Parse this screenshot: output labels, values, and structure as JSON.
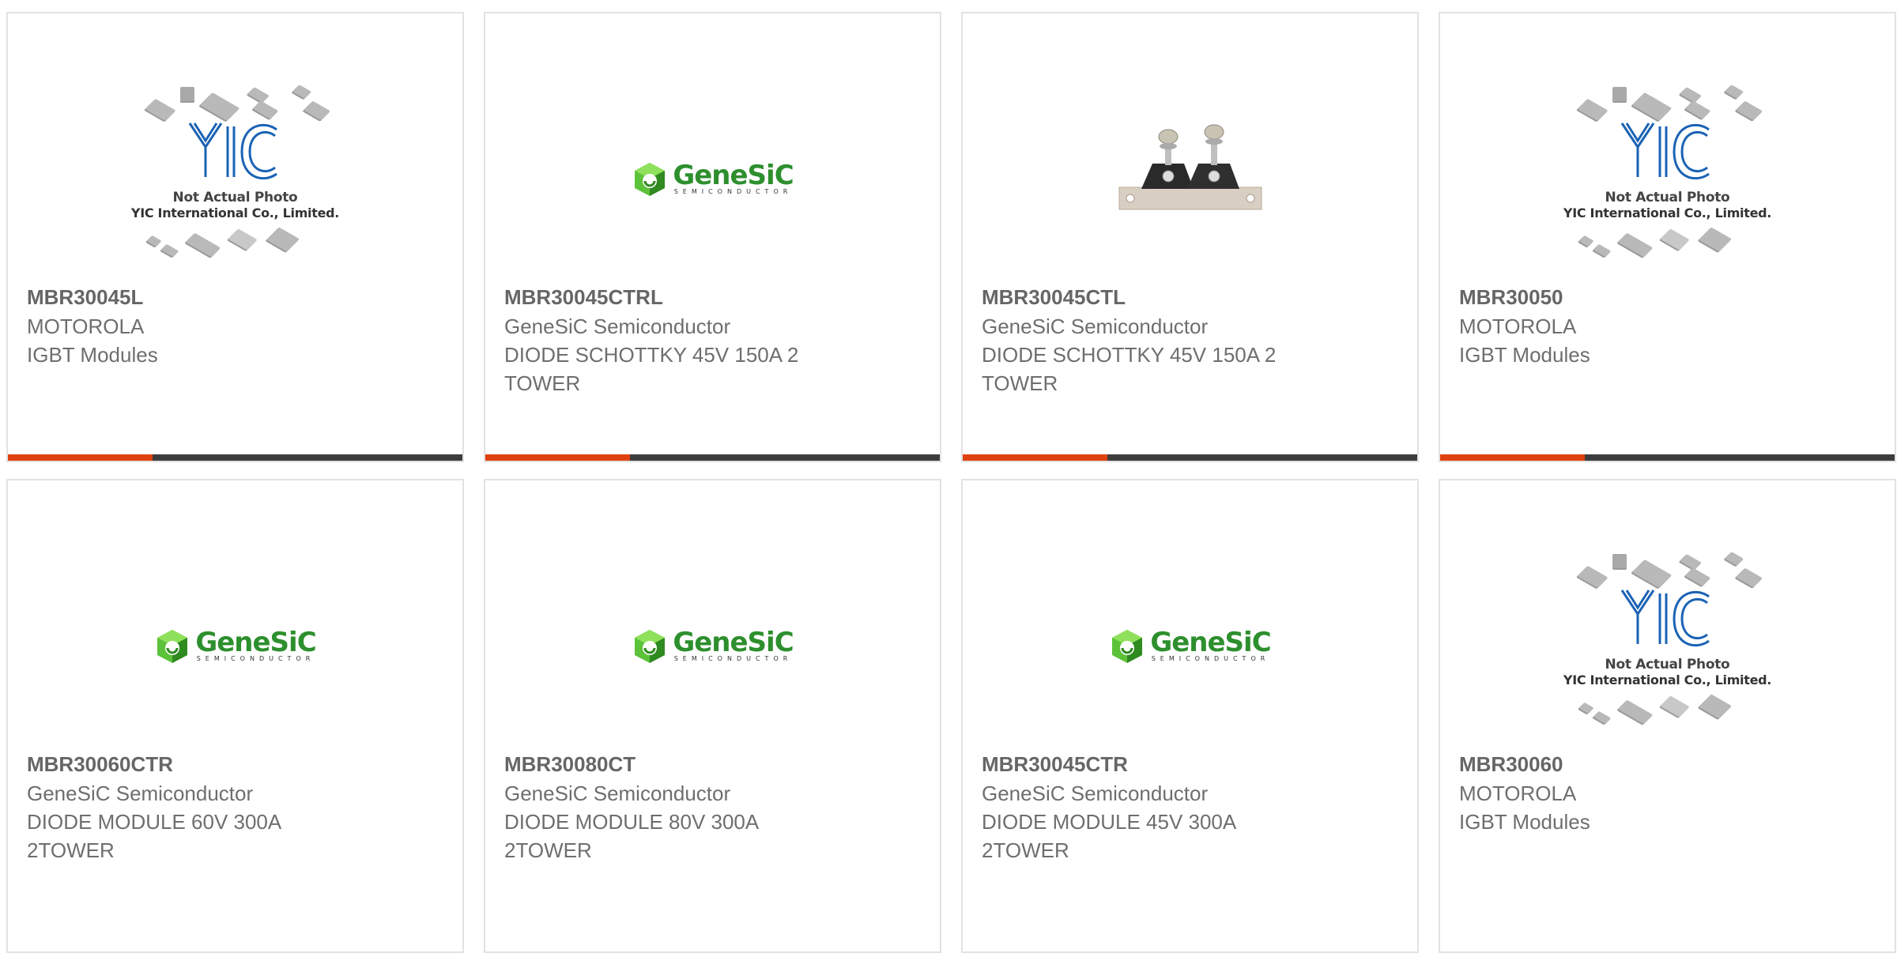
{
  "colors": {
    "accent": "#e0420f",
    "bar": "#3d3d3d",
    "genesic_green": "#3aa82a"
  },
  "products": [
    {
      "image": "yic-placeholder",
      "part": "MBR30045L",
      "maker": "MOTOROLA",
      "desc": "IGBT Modules"
    },
    {
      "image": "genesic-logo",
      "part": "MBR30045CTRL",
      "maker": "GeneSiC Semiconductor",
      "desc": "DIODE SCHOTTKY 45V 150A 2 TOWER"
    },
    {
      "image": "two-tower-diode-photo",
      "part": "MBR30045CTL",
      "maker": "GeneSiC Semiconductor",
      "desc": "DIODE SCHOTTKY 45V 150A 2 TOWER"
    },
    {
      "image": "yic-placeholder",
      "part": "MBR30050",
      "maker": "MOTOROLA",
      "desc": "IGBT Modules"
    },
    {
      "image": "genesic-logo",
      "part": "MBR30060CTR",
      "maker": "GeneSiC Semiconductor",
      "desc": "DIODE MODULE 60V 300A 2TOWER"
    },
    {
      "image": "genesic-logo",
      "part": "MBR30080CT",
      "maker": "GeneSiC Semiconductor",
      "desc": "DIODE MODULE 80V 300A 2TOWER"
    },
    {
      "image": "genesic-logo",
      "part": "MBR30045CTR",
      "maker": "GeneSiC Semiconductor",
      "desc": "DIODE MODULE 45V 300A 2TOWER"
    },
    {
      "image": "yic-placeholder",
      "part": "MBR30060",
      "maker": "MOTOROLA",
      "desc": "IGBT Modules"
    }
  ],
  "placeholder": {
    "line1": "Not Actual Photo",
    "line2": "YIC International Co., Limited.",
    "logo_text": "YIC"
  },
  "genesic": {
    "word": "GeneSiC",
    "sub": "SEMICONDUCTOR"
  }
}
